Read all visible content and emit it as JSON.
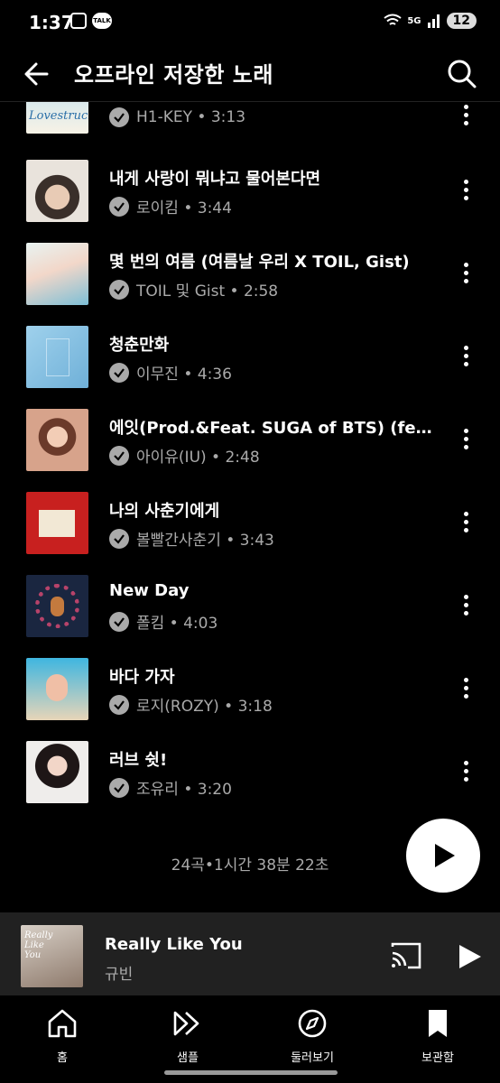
{
  "status": {
    "time": "1:37",
    "talk": "TALK",
    "battery": "12",
    "net": "5G"
  },
  "header": {
    "title": "오프라인 저장한 노래"
  },
  "partial_row": {
    "meta": "H1-KEY • 3:13",
    "art_text": "Lovestruck"
  },
  "songs": [
    {
      "title": "내게 사랑이 뭐냐고 물어본다면",
      "meta": "로이킴 • 3:44"
    },
    {
      "title": "몇 번의 여름 (여름날 우리 X TOIL, Gist)",
      "meta": "TOIL 및 Gist • 2:58"
    },
    {
      "title": "청춘만화",
      "meta": "이무진 • 4:36"
    },
    {
      "title": "에잇(Prod.&Feat. SUGA of BTS) (feat. SUGA)",
      "meta": "아이유(IU) • 2:48"
    },
    {
      "title": "나의 사춘기에게",
      "meta": "볼빨간사춘기 • 3:43"
    },
    {
      "title": "New Day",
      "meta": "폴킴 • 4:03"
    },
    {
      "title": "바다 가자",
      "meta": "로지(ROZY) • 3:18"
    },
    {
      "title": "러브 쉿!",
      "meta": "조유리 • 3:20"
    }
  ],
  "summary": "24곡•1시간 38분 22초",
  "now_playing": {
    "title": "Really Like You",
    "artist": "규빈",
    "art_text": "Really Like You"
  },
  "nav": {
    "items": [
      {
        "label": "홈",
        "icon": "home-icon"
      },
      {
        "label": "샘플",
        "icon": "samples-icon"
      },
      {
        "label": "둘러보기",
        "icon": "explore-icon"
      },
      {
        "label": "보관함",
        "icon": "library-icon"
      }
    ]
  }
}
